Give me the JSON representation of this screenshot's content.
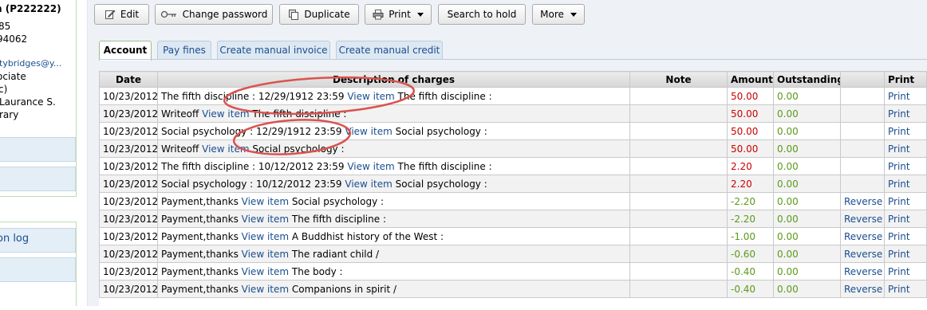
{
  "sidebar": {
    "patron_name": "n (P222222)",
    "lines": [
      "85",
      " 94062",
      "tybridges@y...",
      "ociate",
      "c)",
      "Laurance S.",
      "rary"
    ],
    "nav_link": "on log"
  },
  "toolbar": {
    "edit_label": "Edit",
    "change_password_label": "Change password",
    "duplicate_label": "Duplicate",
    "print_label": "Print",
    "search_to_hold_label": "Search to hold",
    "more_label": "More"
  },
  "tabs": [
    {
      "label": "Account",
      "active": true
    },
    {
      "label": "Pay fines",
      "active": false
    },
    {
      "label": "Create manual invoice",
      "active": false
    },
    {
      "label": "Create manual credit",
      "active": false
    }
  ],
  "table": {
    "headers": [
      "Date",
      "Description of charges",
      "Note",
      "Amount",
      "Outstanding",
      "",
      "Print"
    ],
    "rows": [
      {
        "date": "10/23/2012",
        "desc_pre": "The fifth discipline : 12/29/1912 23:59",
        "link": "View item",
        "desc_post": "The fifth discipline :",
        "note": "",
        "amount": "50.00",
        "amount_type": "pos",
        "outstanding": "0.00",
        "action": "",
        "print": "Print"
      },
      {
        "date": "10/23/2012",
        "desc_pre": "Writeoff",
        "link": "View item",
        "desc_post": "The fifth discipline :",
        "note": "",
        "amount": "50.00",
        "amount_type": "pos",
        "outstanding": "0.00",
        "action": "",
        "print": "Print"
      },
      {
        "date": "10/23/2012",
        "desc_pre": "Social psychology : 12/29/1912 23:59",
        "link": "View item",
        "desc_post": "Social psychology :",
        "note": "",
        "amount": "50.00",
        "amount_type": "pos",
        "outstanding": "0.00",
        "action": "",
        "print": "Print"
      },
      {
        "date": "10/23/2012",
        "desc_pre": "Writeoff",
        "link": "View item",
        "desc_post": "Social psychology :",
        "note": "",
        "amount": "50.00",
        "amount_type": "pos",
        "outstanding": "0.00",
        "action": "",
        "print": "Print"
      },
      {
        "date": "10/23/2012",
        "desc_pre": "The fifth discipline : 10/12/2012 23:59",
        "link": "View item",
        "desc_post": "The fifth discipline :",
        "note": "",
        "amount": "2.20",
        "amount_type": "pos",
        "outstanding": "0.00",
        "action": "",
        "print": "Print"
      },
      {
        "date": "10/23/2012",
        "desc_pre": "Social psychology : 10/12/2012 23:59",
        "link": "View item",
        "desc_post": "Social psychology :",
        "note": "",
        "amount": "2.20",
        "amount_type": "pos",
        "outstanding": "0.00",
        "action": "",
        "print": "Print"
      },
      {
        "date": "10/23/2012",
        "desc_pre": "Payment,thanks",
        "link": "View item",
        "desc_post": "Social psychology :",
        "note": "",
        "amount": "-2.20",
        "amount_type": "neg",
        "outstanding": "0.00",
        "action": "Reverse",
        "print": "Print"
      },
      {
        "date": "10/23/2012",
        "desc_pre": "Payment,thanks",
        "link": "View item",
        "desc_post": "The fifth discipline :",
        "note": "",
        "amount": "-2.20",
        "amount_type": "neg",
        "outstanding": "0.00",
        "action": "Reverse",
        "print": "Print"
      },
      {
        "date": "10/23/2012",
        "desc_pre": "Payment,thanks",
        "link": "View item",
        "desc_post": "A Buddhist history of the West :",
        "note": "",
        "amount": "-1.00",
        "amount_type": "neg",
        "outstanding": "0.00",
        "action": "Reverse",
        "print": "Print"
      },
      {
        "date": "10/23/2012",
        "desc_pre": "Payment,thanks",
        "link": "View item",
        "desc_post": "The radiant child /",
        "note": "",
        "amount": "-0.60",
        "amount_type": "neg",
        "outstanding": "0.00",
        "action": "Reverse",
        "print": "Print"
      },
      {
        "date": "10/23/2012",
        "desc_pre": "Payment,thanks",
        "link": "View item",
        "desc_post": "The body :",
        "note": "",
        "amount": "-0.40",
        "amount_type": "neg",
        "outstanding": "0.00",
        "action": "Reverse",
        "print": "Print"
      },
      {
        "date": "10/23/2012",
        "desc_pre": "Payment,thanks",
        "link": "View item",
        "desc_post": "Companions in spirit /",
        "note": "",
        "amount": "-0.40",
        "amount_type": "neg",
        "outstanding": "0.00",
        "action": "Reverse",
        "print": "Print"
      }
    ]
  },
  "colors": {
    "link": "#1a4d8f",
    "amount_positive": "#cc0000",
    "amount_negative": "#5a9a1a",
    "outstanding": "#5a9a1a",
    "annotation_ellipse": "#d9534f"
  },
  "icons": {
    "edit": "edit-icon",
    "change_password": "key-icon",
    "duplicate": "duplicate-icon",
    "print": "printer-icon",
    "more": "chevron-down-icon"
  }
}
